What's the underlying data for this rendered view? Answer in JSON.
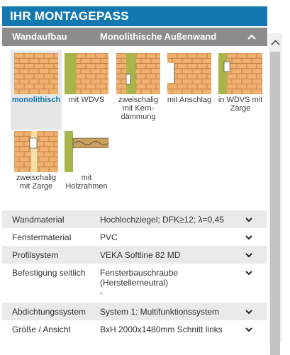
{
  "header": {
    "title": "IHR MONTAGEPASS"
  },
  "section": {
    "label": "Wandaufbau",
    "value": "Monolithische Außenwand"
  },
  "tiles": [
    {
      "label": "monolithisch",
      "selected": true
    },
    {
      "label": "mit WDVS"
    },
    {
      "label": "zweischalig\nmit Kern-\ndämmung"
    },
    {
      "label": "mit Anschlag"
    },
    {
      "label": "in WDVS mit\nZarge"
    },
    {
      "label": "zweischalig\nmit Zarge"
    },
    {
      "label": "mit\nHolzrahmen"
    }
  ],
  "rows": [
    {
      "key": "Wandmaterial",
      "value": "Hochlochziegel; DFK≥12; λ=0,45"
    },
    {
      "key": "Fenstermaterial",
      "value": "PVC"
    },
    {
      "key": "Profilsystem",
      "value": "VEKA Softline 82 MD"
    },
    {
      "key": "Befestigung seitlich",
      "value": "Fensterbauschraube\n(Herstellerneutral)\n-"
    },
    {
      "key": "Abdichtungssystem",
      "value": "System 1: Multifunktionssystem"
    },
    {
      "key": "Größe / Ansicht",
      "value": "BxH 2000x1480mm Schnitt links"
    }
  ],
  "colors": {
    "accent": "#1478b0",
    "bar": "#8c8c8c",
    "brick": "#f0b070",
    "insulation": "#a8b548"
  }
}
